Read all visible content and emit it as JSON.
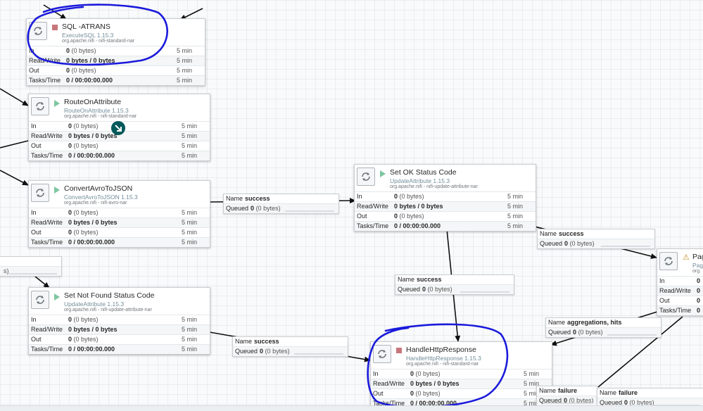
{
  "colors": {
    "accent": "#728e9b",
    "stopped": "#c7777b",
    "running": "#7dc7a0",
    "warning": "#c78f19",
    "edge": "#101010",
    "annotation": "#1a1adb"
  },
  "processors": [
    {
      "id": "p1",
      "name": "SQL -ATRANS",
      "type": "ExecuteSQL 1.15.3",
      "bundle": "org.apache.nifi - nifi-standard-nar",
      "state": "stopped",
      "in_label": "In",
      "in_val": "0",
      "in_sub": "(0 bytes)",
      "in_dur": "5 min",
      "rw_label": "Read/Write",
      "rw_val": "0 bytes / 0 bytes",
      "rw_dur": "5 min",
      "out_label": "Out",
      "out_val": "0",
      "out_sub": "(0 bytes)",
      "out_dur": "5 min",
      "tt_label": "Tasks/Time",
      "tt_val": "0 / 00:00:00.000",
      "tt_dur": "5 min"
    },
    {
      "id": "p2",
      "name": "RouteOnAttribute",
      "type": "RouteOnAttribute 1.15.3",
      "bundle": "org.apache.nifi - nifi-standard-nar",
      "state": "running",
      "in_label": "In",
      "in_val": "0",
      "in_sub": "(0 bytes)",
      "in_dur": "5 min",
      "rw_label": "Read/Write",
      "rw_val": "0 bytes / 0 bytes",
      "rw_dur": "5 min",
      "out_label": "Out",
      "out_val": "0",
      "out_sub": "(0 bytes)",
      "out_dur": "5 min",
      "tt_label": "Tasks/Time",
      "tt_val": "0 / 00:00:00.000",
      "tt_dur": "5 min"
    },
    {
      "id": "p3",
      "name": "ConvertAvroToJSON",
      "type": "ConvertAvroToJSON 1.15.3",
      "bundle": "org.apache.nifi - nifi-avro-nar",
      "state": "running",
      "in_label": "In",
      "in_val": "0",
      "in_sub": "(0 bytes)",
      "in_dur": "5 min",
      "rw_label": "Read/Write",
      "rw_val": "0 bytes / 0 bytes",
      "rw_dur": "5 min",
      "out_label": "Out",
      "out_val": "0",
      "out_sub": "(0 bytes)",
      "out_dur": "5 min",
      "tt_label": "Tasks/Time",
      "tt_val": "0 / 00:00:00.000",
      "tt_dur": "5 min"
    },
    {
      "id": "p4",
      "name": "Set Not Found Status Code",
      "type": "UpdateAttribute 1.15.3",
      "bundle": "org.apache.nifi - nifi-update-attribute-nar",
      "state": "running",
      "in_label": "In",
      "in_val": "0",
      "in_sub": "(0 bytes)",
      "in_dur": "5 min",
      "rw_label": "Read/Write",
      "rw_val": "0 bytes / 0 bytes",
      "rw_dur": "5 min",
      "out_label": "Out",
      "out_val": "0",
      "out_sub": "(0 bytes)",
      "out_dur": "5 min",
      "tt_label": "Tasks/Time",
      "tt_val": "0 / 00:00:00.000",
      "tt_dur": "5 min"
    },
    {
      "id": "p5",
      "name": "Set OK Status Code",
      "type": "UpdateAttribute 1.15.3",
      "bundle": "org.apache.nifi - nifi-update-attribute-nar",
      "state": "running",
      "in_label": "In",
      "in_val": "0",
      "in_sub": "(0 bytes)",
      "in_dur": "5 min",
      "rw_label": "Read/Write",
      "rw_val": "0 bytes / 0 bytes",
      "rw_dur": "5 min",
      "out_label": "Out",
      "out_val": "0",
      "out_sub": "(0 bytes)",
      "out_dur": "5 min",
      "tt_label": "Tasks/Time",
      "tt_val": "0 / 00:00:00.000",
      "tt_dur": "5 min"
    },
    {
      "id": "p6",
      "name": "HandleHttpResponse",
      "type": "HandleHttpResponse 1.15.3",
      "bundle": "org.apache.nifi - nifi-standard-nar",
      "state": "stopped",
      "in_label": "In",
      "in_val": "0",
      "in_sub": "(0 bytes)",
      "in_dur": "5 min",
      "rw_label": "Read/Write",
      "rw_val": "0 bytes / 0 bytes",
      "rw_dur": "5 min",
      "out_label": "Out",
      "out_val": "0",
      "out_sub": "(0 bytes)",
      "out_dur": "5 min",
      "tt_label": "Tasks/Time",
      "tt_val": "0 / 00:00:00.000",
      "tt_dur": "5 min"
    },
    {
      "id": "p7",
      "name": "Pag",
      "type": "Pag",
      "bundle": "org.",
      "state": "warn",
      "in_label": "In",
      "in_val": "0",
      "in_sub": "",
      "in_dur": "",
      "rw_label": "Read/Write",
      "rw_val": "0",
      "rw_dur": "",
      "out_label": "Out",
      "out_val": "0",
      "out_sub": "",
      "out_dur": "",
      "tt_label": "Tasks/Time",
      "tt_val": "0",
      "tt_dur": ""
    }
  ],
  "warn_glyph": "⚠",
  "connections": [
    {
      "id": "c1",
      "name_label": "Name",
      "name": "success",
      "queued_label": "Queued",
      "queued": "0",
      "queued_sub": "(0 bytes)"
    },
    {
      "id": "c2",
      "name_label": "Name",
      "name": "success",
      "queued_label": "Queued",
      "queued": "0",
      "queued_sub": "(0 bytes)"
    },
    {
      "id": "c3",
      "name_label": "Name",
      "name": "success",
      "queued_label": "Queued",
      "queued": "0",
      "queued_sub": "(0 bytes)"
    },
    {
      "id": "c4",
      "name_label": "Name",
      "name": "success",
      "queued_label": "Queued",
      "queued": "0",
      "queued_sub": "(0 bytes)"
    },
    {
      "id": "c5",
      "name_label": "Name",
      "name": "aggregations, hits",
      "queued_label": "Queued",
      "queued": "0",
      "queued_sub": "(0 bytes)"
    },
    {
      "id": "c6",
      "name_label": "Name",
      "name": "failure",
      "queued_label": "Queued",
      "queued": "0",
      "queued_sub": "(0 bytes)"
    },
    {
      "id": "c7",
      "name_label": "Name",
      "name": "failure",
      "queued_label": "Queued",
      "queued": "0",
      "queued_sub": "(0 bytes)"
    },
    {
      "id": "c8",
      "name_label": "",
      "name": "",
      "queued_label": "",
      "queued": "",
      "queued_sub": "s)"
    }
  ]
}
